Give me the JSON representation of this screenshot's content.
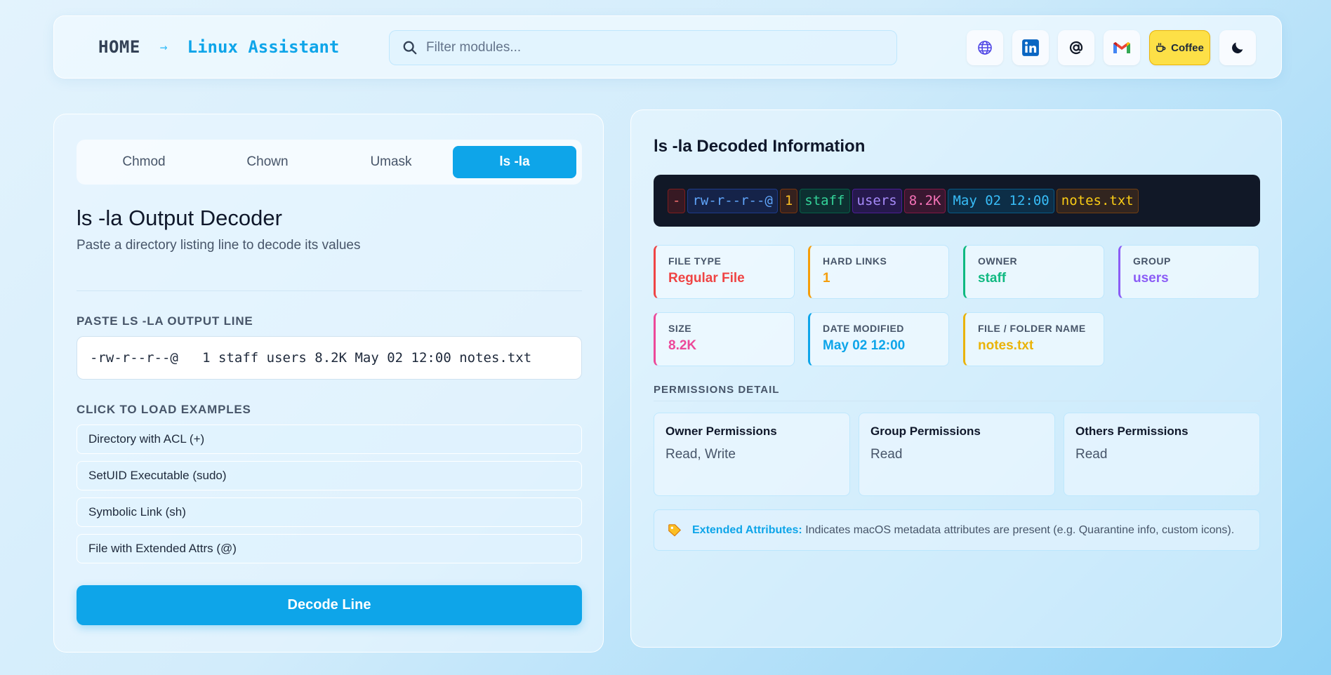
{
  "header": {
    "home": "HOME",
    "arrow": "→",
    "current": "Linux Assistant",
    "search_placeholder": "Filter modules...",
    "icons": [
      "globe-icon",
      "linkedin-icon",
      "at-icon",
      "gmail-icon",
      "coffee-icon",
      "moon-icon"
    ],
    "coffee_label": "Coffee"
  },
  "left": {
    "tabs": [
      "Chmod",
      "Chown",
      "Umask",
      "ls -la"
    ],
    "active_tab": "ls -la",
    "title": "ls -la Output Decoder",
    "subtitle": "Paste a directory listing line to decode its values",
    "input_label": "PASTE LS -LA OUTPUT LINE",
    "input_value": "-rw-r--r--@   1 staff users 8.2K May 02 12:00 notes.txt",
    "examples_label": "CLICK TO LOAD EXAMPLES",
    "examples": [
      "Directory with ACL (+)",
      "SetUID Executable (sudo)",
      "Symbolic Link (sh)",
      "File with Extended Attrs (@)"
    ],
    "decode_button": "Decode Line"
  },
  "right": {
    "title": "ls -la Decoded Information",
    "tokens": [
      "-",
      "rw-r--r--@",
      "1",
      "staff",
      "users",
      "8.2K",
      "May 02 12:00",
      "notes.txt"
    ],
    "cards": [
      {
        "label": "FILE TYPE",
        "value": "Regular File",
        "color": "#ef4444"
      },
      {
        "label": "HARD LINKS",
        "value": "1",
        "color": "#f59e0b"
      },
      {
        "label": "OWNER",
        "value": "staff",
        "color": "#10b981"
      },
      {
        "label": "GROUP",
        "value": "users",
        "color": "#8b5cf6"
      },
      {
        "label": "SIZE",
        "value": "8.2K",
        "color": "#ec4899"
      },
      {
        "label": "DATE MODIFIED",
        "value": "May 02 12:00",
        "color": "#0ea5e9"
      },
      {
        "label": "FILE / FOLDER NAME",
        "value": "notes.txt",
        "color": "#eab308"
      }
    ],
    "permissions_label": "PERMISSIONS DETAIL",
    "permissions": [
      {
        "title": "Owner Permissions",
        "value": "Read, Write"
      },
      {
        "title": "Group Permissions",
        "value": "Read"
      },
      {
        "title": "Others Permissions",
        "value": "Read"
      }
    ],
    "extended": {
      "label": "Extended Attributes:",
      "text": "Indicates macOS metadata attributes are present (e.g. Quarantine info, custom icons)."
    }
  }
}
